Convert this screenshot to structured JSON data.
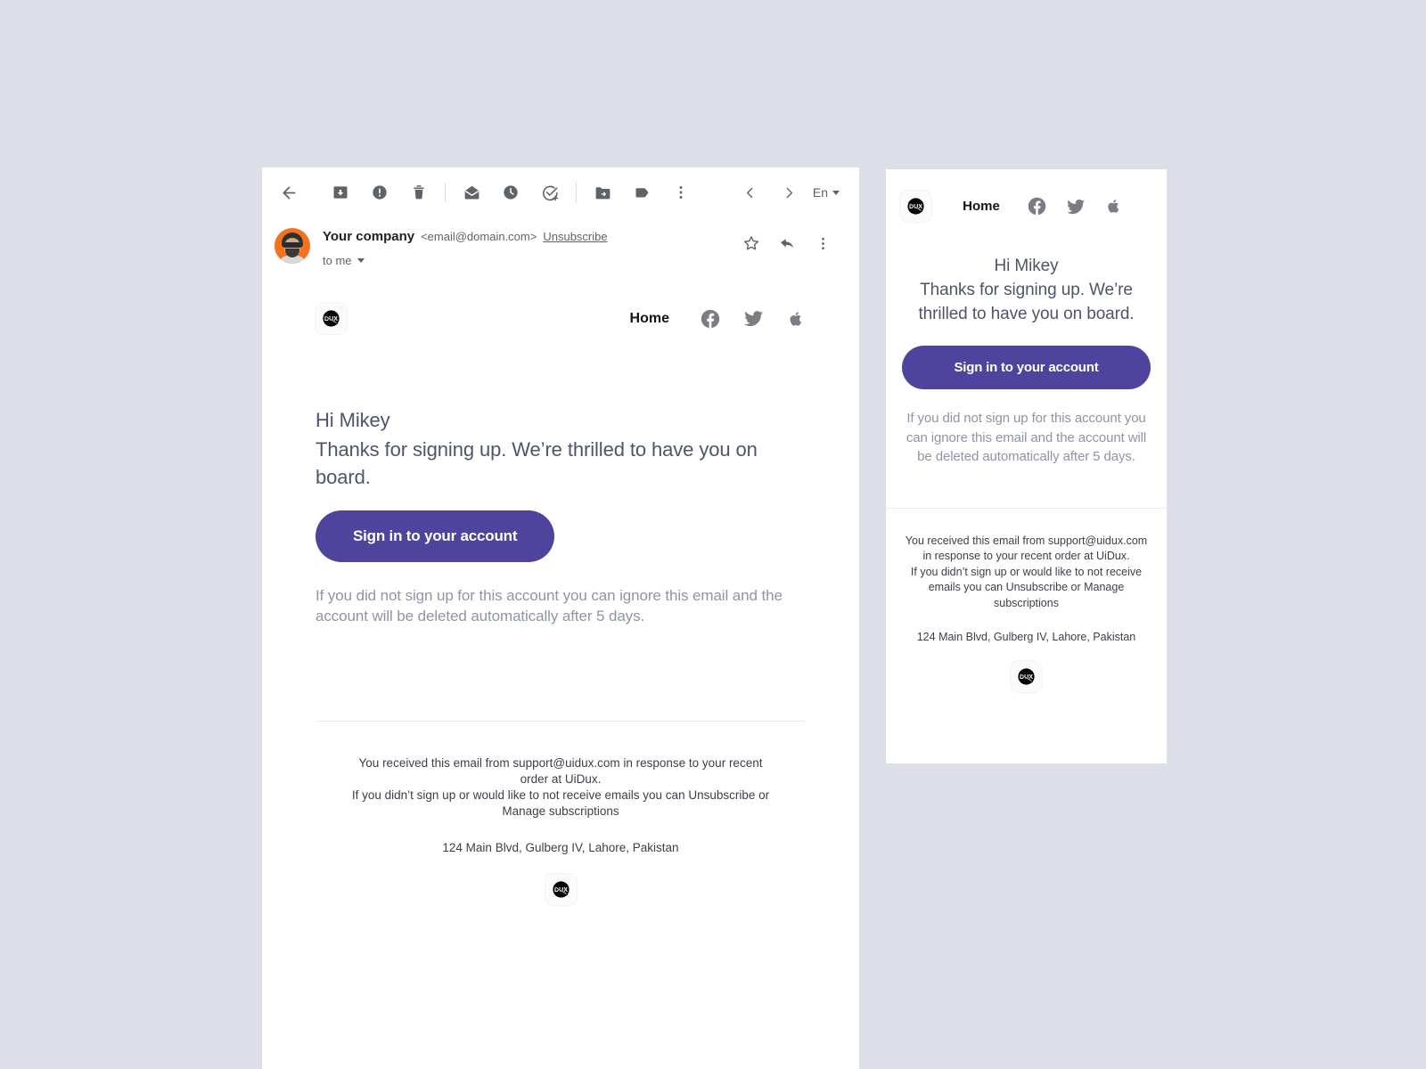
{
  "theme": {
    "page_background": "#dcdfe8",
    "panel_background": "#ffffff",
    "accent_purple": "#4f449d",
    "body_text": "#4f5566",
    "muted_text": "#8f94a6",
    "icon_gray": "#5f6368",
    "social_gray": "#7c7c85",
    "avatar_orange": "#f4711f"
  },
  "toolbar": {
    "back_label": "Back",
    "archive_label": "Archive",
    "report_spam_label": "Report spam",
    "delete_label": "Delete",
    "mark_unread_label": "Mark as unread",
    "snooze_label": "Snooze",
    "add_to_tasks_label": "Add to tasks",
    "move_to_label": "Move to",
    "labels_label": "Labels",
    "more_label": "More",
    "prev_label": "Newer",
    "next_label": "Older",
    "language": "En"
  },
  "message_header": {
    "sender_name": "Your company",
    "sender_email": "<email@domain.com>",
    "unsubscribe_label": "Unsubscribe",
    "recipient": "to me",
    "star_label": "Star",
    "reply_label": "Reply",
    "more_label": "More"
  },
  "email": {
    "brand": {
      "logo_text": "DUX",
      "nav_home": "Home",
      "social": [
        {
          "name": "facebook-icon",
          "label": "Facebook"
        },
        {
          "name": "twitter-icon",
          "label": "Twitter"
        },
        {
          "name": "apple-icon",
          "label": "Apple"
        }
      ]
    },
    "hero": {
      "greeting": "Hi Mikey",
      "subtitle": "Thanks for signing up. We’re thrilled to have you on board.",
      "cta_label": "Sign in to your account",
      "note": "If you did not sign up for this account you can ignore this email and the account will be deleted automatically after 5 days."
    },
    "footer": {
      "line1": "You received this email from support@uidux.com in response to your recent order at UiDux.",
      "line2": "If you didn’t sign up or would like to not receive emails you can Unsubscribe or Manage subscriptions",
      "address": "124 Main Blvd, Gulberg IV, Lahore, Pakistan",
      "logo_text": "DUX"
    }
  },
  "mobile": {
    "brand": {
      "logo_text": "DUX",
      "nav_home": "Home"
    },
    "hero": {
      "greeting": "Hi Mikey",
      "subtitle": "Thanks for signing up. We’re thrilled to have you on board.",
      "cta_label": "Sign in to your account",
      "note": "If you did not sign up for this account you can ignore this email and the account will be deleted automatically after 5 days."
    },
    "footer": {
      "line1": "You received this email from support@uidux.com in response to your recent order at UiDux.",
      "line2": "If you didn’t sign up or would like to not receive emails you can Unsubscribe or Manage subscriptions",
      "address": "124 Main Blvd, Gulberg IV, Lahore, Pakistan",
      "logo_text": "DUX"
    }
  }
}
